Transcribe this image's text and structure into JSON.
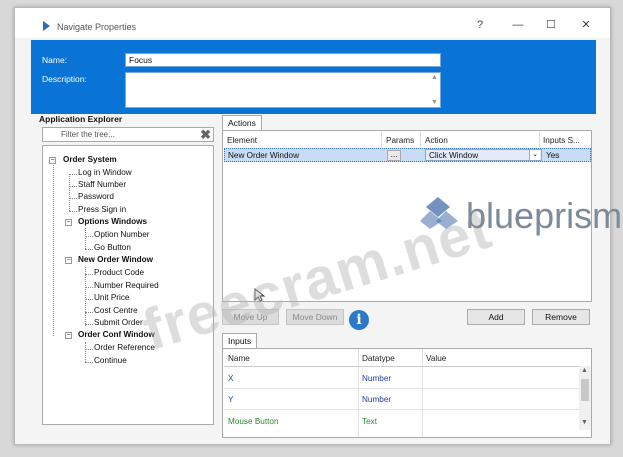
{
  "window": {
    "title": "Navigate Properties",
    "help_icon": "?",
    "minimize_icon": "—",
    "maximize_icon": "☐",
    "close_icon": "✕"
  },
  "properties": {
    "name_label": "Name:",
    "name_value": "Focus",
    "description_label": "Description:",
    "description_value": ""
  },
  "explorer": {
    "title": "Application Explorer",
    "filter_placeholder": "Filter the tree...",
    "clear_icon": "✖",
    "tree": {
      "order_system": "Order System",
      "login_window": "Log in Window",
      "staff_number": "Staff Number",
      "password": "Password",
      "press_sign_in": "Press Sign in",
      "options_windows": "Options Windows",
      "option_number": "Option Number",
      "go_button": "Go Button",
      "new_order_window": "New Order Window",
      "product_code": "Product Code",
      "number_required": "Number Required",
      "unit_price": "Unit Price",
      "cost_centre": "Cost Centre",
      "submit_order": "Submit Order",
      "order_conf_window": "Order Conf Window",
      "order_reference": "Order Reference",
      "continue": "Continue"
    }
  },
  "actions": {
    "tab_label": "Actions",
    "columns": {
      "element": "Element",
      "params": "Params",
      "action": "Action",
      "inputs": "Inputs S..."
    },
    "row": {
      "element": "New Order Window",
      "params": "...",
      "action": "Click Window",
      "inputs": "Yes"
    },
    "move_up": "Move Up",
    "move_down": "Move Down",
    "info_icon": "i",
    "add": "Add",
    "remove": "Remove"
  },
  "inputs": {
    "tab_label": "Inputs",
    "columns": {
      "name": "Name",
      "datatype": "Datatype",
      "value": "Value"
    },
    "rows": [
      {
        "name": "X",
        "datatype": "Number",
        "value": ""
      },
      {
        "name": "Y",
        "datatype": "Number",
        "value": ""
      },
      {
        "name": "Mouse Button",
        "datatype": "Text",
        "value": ""
      }
    ]
  },
  "watermark": {
    "text": "freecram.net",
    "brand": "blueprism"
  },
  "colors": {
    "header_blue": "#0a74d6",
    "selected_row": "#c8dcf5",
    "input_name_blue": "#1f3fa0",
    "input_name_green": "#2a8a2a"
  }
}
